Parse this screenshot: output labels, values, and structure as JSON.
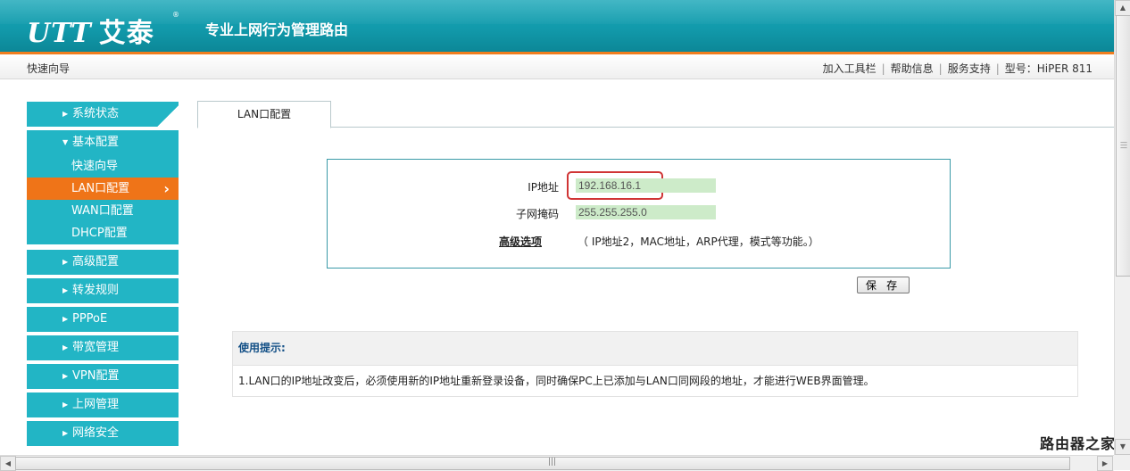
{
  "header": {
    "logo_mark": "UTT",
    "logo_text": "艾泰",
    "logo_registered": "®",
    "slogan": "专业上网行为管理路由"
  },
  "subbar": {
    "left": "快速向导",
    "links": [
      "加入工具栏",
      "帮助信息",
      "服务支持"
    ],
    "model": "型号：HiPER 811"
  },
  "sidebar": {
    "items_top": [
      {
        "label": "系统状态"
      },
      {
        "label": "基本配置"
      }
    ],
    "submenu": [
      {
        "label": "快速向导",
        "active": false
      },
      {
        "label": "LAN口配置",
        "active": true
      },
      {
        "label": "WAN口配置",
        "active": false
      },
      {
        "label": "DHCP配置",
        "active": false
      }
    ],
    "items_bottom": [
      {
        "label": "高级配置"
      },
      {
        "label": "转发规则"
      },
      {
        "label": "PPPoE"
      },
      {
        "label": "带宽管理"
      },
      {
        "label": "VPN配置"
      },
      {
        "label": "上网管理"
      },
      {
        "label": "网络安全"
      }
    ]
  },
  "tab": {
    "label": "LAN口配置"
  },
  "form": {
    "ip_label": "IP地址",
    "ip_value": "192.168.16.1",
    "mask_label": "子网掩码",
    "mask_value": "255.255.255.0",
    "advanced_label": "高级选项",
    "advanced_desc": "（ IP地址2，MAC地址，ARP代理，模式等功能。）",
    "save_label": "保 存"
  },
  "tips": {
    "title": "使用提示:",
    "line1": "1.LAN口的IP地址改变后，必须使用新的IP地址重新登录设备，同时确保PC上已添加与LAN口同网段的地址，才能进行WEB界面管理。"
  },
  "watermark": "路由器之家",
  "colors": {
    "teal": "#1aa7b8",
    "orange": "#ef7418",
    "menu": "#22b5c5",
    "field": "#cdebc9",
    "highlight": "#d03535"
  }
}
